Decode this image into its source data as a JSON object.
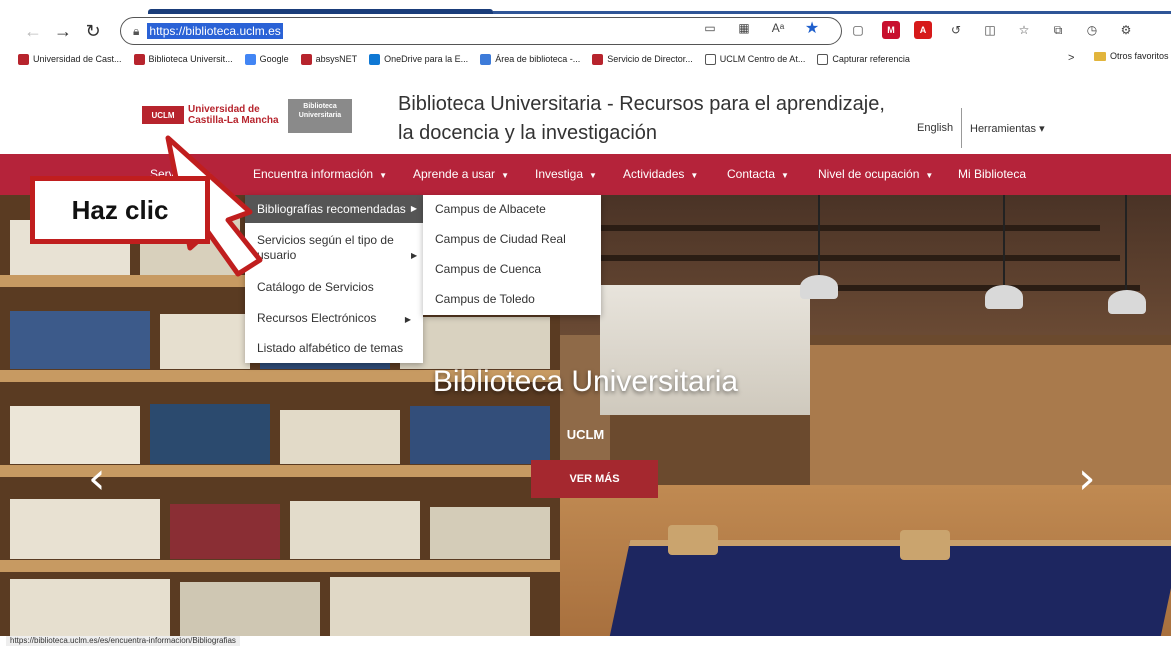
{
  "browser": {
    "url": "https://biblioteca.uclm.es",
    "bookmarks": [
      {
        "label": "Universidad de Cast...",
        "color": "#b7242d"
      },
      {
        "label": "Biblioteca Universit...",
        "color": "#b7242d"
      },
      {
        "label": "Google",
        "color": "#4285f4"
      },
      {
        "label": "absysNET",
        "color": "#b7242d"
      },
      {
        "label": "OneDrive para la E...",
        "color": "#0f78d4"
      },
      {
        "label": "Área de biblioteca -...",
        "color": "#3d7bd9"
      },
      {
        "label": "Servicio de Director...",
        "color": "#b7242d"
      },
      {
        "label": "UCLM Centro de At...",
        "color": "#555555"
      },
      {
        "label": "Capturar referencia",
        "color": "#555555"
      }
    ],
    "bookmarks_more": ">",
    "other_favorites": "Otros favoritos",
    "status_url": "https://biblioteca.uclm.es/es/encuentra-informacion/Bibliografias"
  },
  "header": {
    "logo_uclm_badge": "UCLM",
    "logo_uclm_line1": "Universidad de",
    "logo_uclm_line2": "Castilla-La Mancha",
    "logo_bib": "Biblioteca Universitaria",
    "title_line1": "Biblioteca Universitaria - Recursos para el aprendizaje,",
    "title_line2": "la docencia y la investigación",
    "lang": "English",
    "tools": "Herramientas ▾"
  },
  "nav": {
    "items": [
      {
        "label": "Servicios",
        "caret": true
      },
      {
        "label": "Encuentra información",
        "caret": true
      },
      {
        "label": "Aprende a usar",
        "caret": true
      },
      {
        "label": "Investiga",
        "caret": true
      },
      {
        "label": "Actividades",
        "caret": true
      },
      {
        "label": "Contacta",
        "caret": true
      },
      {
        "label": "Nivel de ocupación",
        "caret": true
      },
      {
        "label": "Mi Biblioteca",
        "caret": false
      }
    ]
  },
  "dropdown": {
    "items": [
      "Bibliografías recomendadas",
      "Servicios según el tipo de usuario",
      "Catálogo de Servicios",
      "Recursos Electrónicos",
      "Listado alfabético de temas"
    ],
    "submenu": [
      "Campus de Albacete",
      "Campus de Ciudad Real",
      "Campus de Cuenca",
      "Campus de Toledo"
    ]
  },
  "hero": {
    "title": "Biblioteca Universitaria",
    "subtitle": "UCLM",
    "button": "VER MÁS"
  },
  "annotation": {
    "text": "Haz clic",
    "color": "#c01e1e"
  },
  "colors": {
    "brand_red": "#b5233a",
    "button_red": "#a5282f"
  }
}
